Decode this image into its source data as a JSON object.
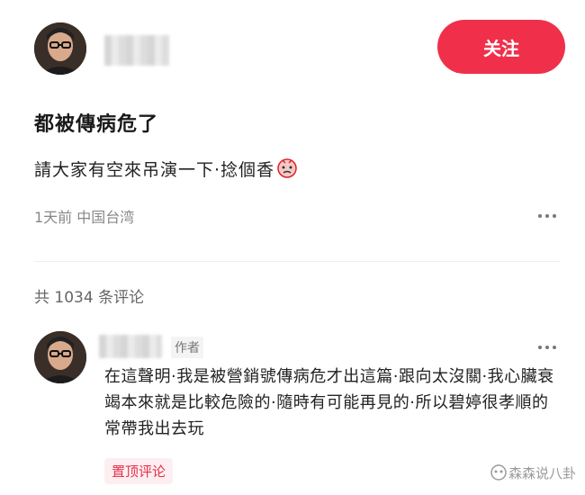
{
  "post": {
    "follow_label": "关注",
    "title": "都被傳病危了",
    "body": "請大家有空來吊演一下·捻個香",
    "meta": "1天前  中国台湾"
  },
  "comments_header": {
    "count_label": "共 1034 条评论"
  },
  "comment": {
    "author_tag": "作者",
    "text": "在這聲明·我是被營銷號傳病危才出這篇·跟向太沒關·我心臟衰竭本來就是比較危險的·隨時有可能再見的·所以碧婷很孝順的常帶我出去玩",
    "pinned_label": "置顶评论"
  },
  "watermark": {
    "text": "森森说八卦"
  },
  "colors": {
    "accent": "#f0304a",
    "pinned_bg": "#fdeff1"
  }
}
